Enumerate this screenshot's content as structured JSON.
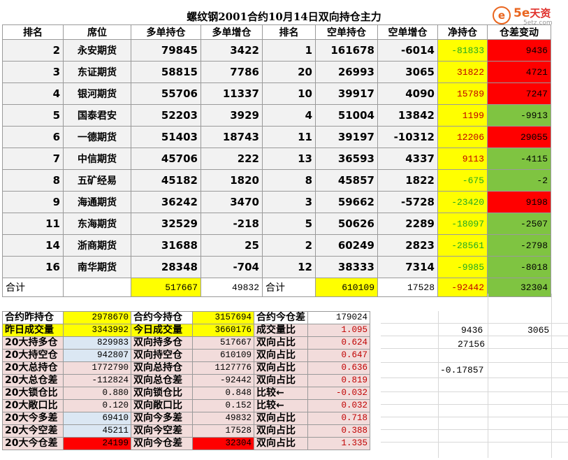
{
  "title": "螺纹钢2001合约10月14日双向持仓主力",
  "logo": {
    "mark": "e",
    "brand_prefix": "5e",
    "brand_zh": "天资",
    "site": "5etz.com"
  },
  "headers": [
    "排名",
    "席位",
    "多单持仓",
    "多单增仓",
    "排名",
    "空单持仓",
    "空单增仓",
    "净持仓",
    "仓差变动"
  ],
  "rows": [
    {
      "rank": "2",
      "seat": "永安期货",
      "long": "79845",
      "long_chg": "3422",
      "srank": "1",
      "short": "161678",
      "short_chg": "-6014",
      "net": "-81833",
      "diff": "9436",
      "diff_c": "red"
    },
    {
      "rank": "3",
      "seat": "东证期货",
      "long": "58815",
      "long_chg": "7786",
      "srank": "20",
      "short": "26993",
      "short_chg": "3065",
      "net": "31822",
      "diff": "4721",
      "diff_c": "red"
    },
    {
      "rank": "4",
      "seat": "银河期货",
      "long": "55706",
      "long_chg": "11337",
      "srank": "10",
      "short": "39917",
      "short_chg": "4090",
      "net": "15789",
      "diff": "7247",
      "diff_c": "red"
    },
    {
      "rank": "5",
      "seat": "国泰君安",
      "long": "52203",
      "long_chg": "3929",
      "srank": "4",
      "short": "51004",
      "short_chg": "13842",
      "net": "1199",
      "diff": "-9913",
      "diff_c": "grn"
    },
    {
      "rank": "6",
      "seat": "一德期货",
      "long": "51403",
      "long_chg": "18743",
      "srank": "11",
      "short": "39197",
      "short_chg": "-10312",
      "net": "12206",
      "diff": "29055",
      "diff_c": "red"
    },
    {
      "rank": "7",
      "seat": "中信期货",
      "long": "45706",
      "long_chg": "222",
      "srank": "13",
      "short": "36593",
      "short_chg": "4337",
      "net": "9113",
      "diff": "-4115",
      "diff_c": "grn"
    },
    {
      "rank": "8",
      "seat": "五矿经易",
      "long": "45182",
      "long_chg": "1820",
      "srank": "8",
      "short": "45857",
      "short_chg": "1822",
      "net": "-675",
      "diff": "-2",
      "diff_c": "grn"
    },
    {
      "rank": "9",
      "seat": "海通期货",
      "long": "36242",
      "long_chg": "3470",
      "srank": "3",
      "short": "59662",
      "short_chg": "-5728",
      "net": "-23420",
      "diff": "9198",
      "diff_c": "red"
    },
    {
      "rank": "11",
      "seat": "东海期货",
      "long": "32529",
      "long_chg": "-218",
      "srank": "5",
      "short": "50626",
      "short_chg": "2289",
      "net": "-18097",
      "diff": "-2507",
      "diff_c": "grn"
    },
    {
      "rank": "14",
      "seat": "浙商期货",
      "long": "31688",
      "long_chg": "25",
      "srank": "2",
      "short": "60249",
      "short_chg": "2823",
      "net": "-28561",
      "diff": "-2798",
      "diff_c": "grn"
    },
    {
      "rank": "16",
      "seat": "南华期货",
      "long": "28348",
      "long_chg": "-704",
      "srank": "12",
      "short": "38333",
      "short_chg": "7314",
      "net": "-9985",
      "diff": "-8018",
      "diff_c": "grn"
    }
  ],
  "total": {
    "label": "合计",
    "long": "517667",
    "long_chg": "49832",
    "label2": "合计",
    "short": "610109",
    "short_chg": "17528",
    "net": "-92442",
    "diff": "32304"
  },
  "stats": [
    [
      {
        "t": "合约昨持仓"
      },
      {
        "t": "2978670",
        "c": "ye v"
      },
      {
        "t": "合约今持仓"
      },
      {
        "t": "3157694",
        "c": "ye v"
      },
      {
        "t": "合约今仓差"
      },
      {
        "t": "179024",
        "c": "wh v"
      }
    ],
    [
      {
        "t": "昨日成交量",
        "c": "ye"
      },
      {
        "t": "3343992",
        "c": "ye v"
      },
      {
        "t": "今日成交量",
        "c": "ye"
      },
      {
        "t": "3660176",
        "c": "ye v"
      },
      {
        "t": "成交量比",
        "c": "pk"
      },
      {
        "t": "1.095",
        "c": "pk v rv"
      }
    ],
    [
      {
        "t": "20大持多仓",
        "c": "pk"
      },
      {
        "t": "829983",
        "c": "bl v"
      },
      {
        "t": "双向持多仓",
        "c": "pk"
      },
      {
        "t": "517667",
        "c": "pk v"
      },
      {
        "t": "双向占比",
        "c": "pk"
      },
      {
        "t": "0.624",
        "c": "pk v rv"
      }
    ],
    [
      {
        "t": "20大持空仓",
        "c": "pk"
      },
      {
        "t": "942807",
        "c": "bl v"
      },
      {
        "t": "双向持空仓",
        "c": "pk"
      },
      {
        "t": "610109",
        "c": "pk v"
      },
      {
        "t": "双向占比",
        "c": "pk"
      },
      {
        "t": "0.647",
        "c": "pk v rv"
      }
    ],
    [
      {
        "t": "20大总持仓",
        "c": "pk"
      },
      {
        "t": "1772790",
        "c": "pk v"
      },
      {
        "t": "双向总持仓",
        "c": "pk"
      },
      {
        "t": "1127776",
        "c": "pk v"
      },
      {
        "t": "双向占比",
        "c": "pk"
      },
      {
        "t": "0.636",
        "c": "pk v rv"
      }
    ],
    [
      {
        "t": "20大总仓差",
        "c": "pk"
      },
      {
        "t": "-112824",
        "c": "pk v"
      },
      {
        "t": "双向总仓差",
        "c": "pk"
      },
      {
        "t": "-92442",
        "c": "pk v"
      },
      {
        "t": "双向占比",
        "c": "pk"
      },
      {
        "t": "0.819",
        "c": "pk v rv"
      }
    ],
    [
      {
        "t": "20大锁仓比",
        "c": "pk"
      },
      {
        "t": "0.880",
        "c": "pk v"
      },
      {
        "t": "双向锁仓比",
        "c": "pk"
      },
      {
        "t": "0.848",
        "c": "pk v"
      },
      {
        "t": "比较←",
        "c": "pk"
      },
      {
        "t": "-0.032",
        "c": "pk v rv"
      }
    ],
    [
      {
        "t": "20大敞口比",
        "c": "pk"
      },
      {
        "t": "0.120",
        "c": "pk v"
      },
      {
        "t": "双向敞口比",
        "c": "pk"
      },
      {
        "t": "0.152",
        "c": "pk v"
      },
      {
        "t": "比较←",
        "c": "pk"
      },
      {
        "t": "0.032",
        "c": "pk v rv"
      }
    ],
    [
      {
        "t": "20大今多差",
        "c": "pk"
      },
      {
        "t": "69410",
        "c": "bl v"
      },
      {
        "t": "双向今多差",
        "c": "pk"
      },
      {
        "t": "49832",
        "c": "pk v"
      },
      {
        "t": "双向占比",
        "c": "pk"
      },
      {
        "t": "0.718",
        "c": "pk v rv"
      }
    ],
    [
      {
        "t": "20大今空差",
        "c": "pk"
      },
      {
        "t": "45211",
        "c": "bl v"
      },
      {
        "t": "双向今空差",
        "c": "pk"
      },
      {
        "t": "17528",
        "c": "pk v"
      },
      {
        "t": "双向占比",
        "c": "pk"
      },
      {
        "t": "0.388",
        "c": "pk v rv"
      }
    ],
    [
      {
        "t": "20大今仓差",
        "c": "pk"
      },
      {
        "t": "24199",
        "c": "rd v"
      },
      {
        "t": "双向今仓差",
        "c": "pk"
      },
      {
        "t": "32304",
        "c": "rd v"
      },
      {
        "t": "双向占比",
        "c": "pk"
      },
      {
        "t": "1.335",
        "c": "pk v rv"
      }
    ]
  ],
  "side_values": {
    "a": "9436",
    "b": "3065",
    "c": "27156",
    "d": "-0.17857"
  }
}
